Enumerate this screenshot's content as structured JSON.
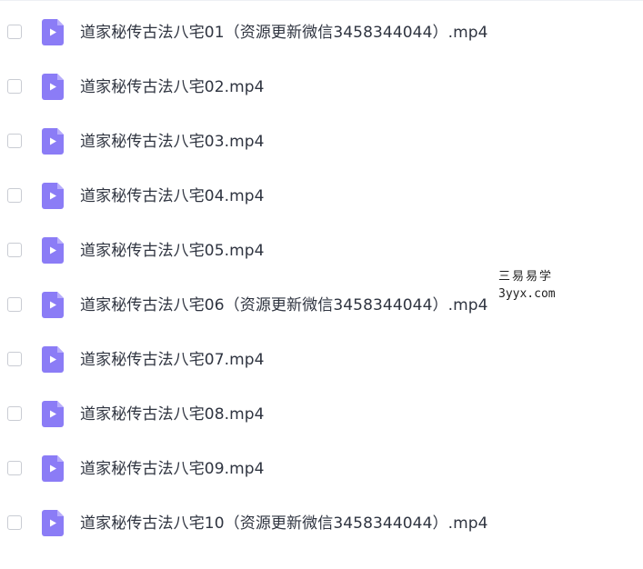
{
  "files": [
    {
      "name": "道家秘传古法八宅01（资源更新微信3458344044）.mp4",
      "icon": "video-file-icon"
    },
    {
      "name": "道家秘传古法八宅02.mp4",
      "icon": "video-file-icon"
    },
    {
      "name": "道家秘传古法八宅03.mp4",
      "icon": "video-file-icon"
    },
    {
      "name": "道家秘传古法八宅04.mp4",
      "icon": "video-file-icon"
    },
    {
      "name": "道家秘传古法八宅05.mp4",
      "icon": "video-file-icon"
    },
    {
      "name": "道家秘传古法八宅06（资源更新微信3458344044）.mp4",
      "icon": "video-file-icon"
    },
    {
      "name": "道家秘传古法八宅07.mp4",
      "icon": "video-file-icon"
    },
    {
      "name": "道家秘传古法八宅08.mp4",
      "icon": "video-file-icon"
    },
    {
      "name": "道家秘传古法八宅09.mp4",
      "icon": "video-file-icon"
    },
    {
      "name": "道家秘传古法八宅10（资源更新微信3458344044）.mp4",
      "icon": "video-file-icon"
    }
  ],
  "watermark": {
    "line1": "三易易学",
    "line2": "3yyx.com"
  },
  "colors": {
    "icon_purple": "#8b7cf6",
    "icon_fold": "#b8adfb",
    "text": "#2f3440",
    "checkbox_border": "#c9ccd3"
  }
}
